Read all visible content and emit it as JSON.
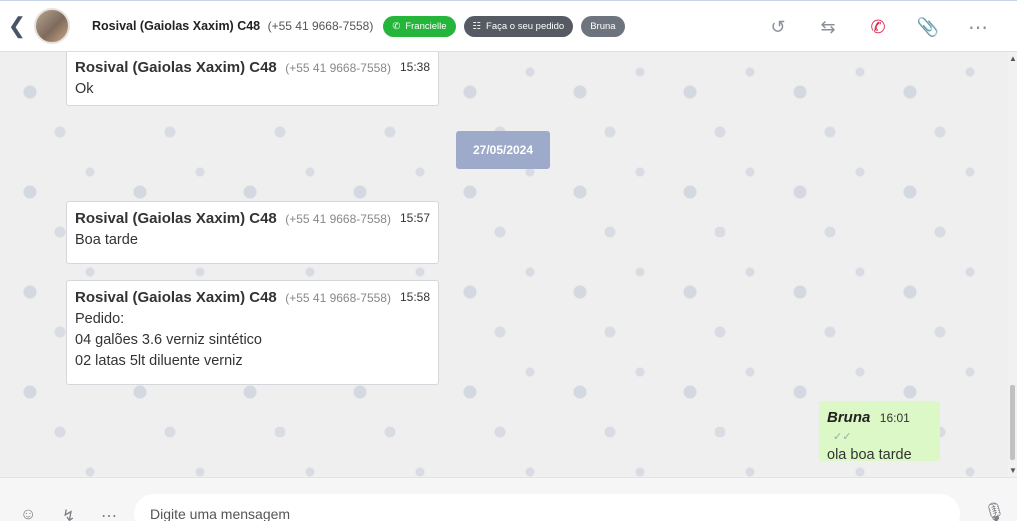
{
  "header": {
    "contact_name": "Rosival (Gaiolas Xaxim) C48",
    "contact_phone": "(+55 41 9668-7558)",
    "tags": [
      "Francielle",
      "Faça o seu pedido",
      "Bruna"
    ],
    "icons": [
      "history-icon",
      "transfer-icon",
      "call-end-icon",
      "attach-icon",
      "more-icon"
    ]
  },
  "messages": [
    {
      "name": "Rosival (Gaiolas Xaxim) C48",
      "phone": "(+55 41 9668-7558)",
      "time": "15:38",
      "lines": [
        "Ok"
      ]
    },
    {
      "name": "Rosival (Gaiolas Xaxim) C48",
      "phone": "(+55 41 9668-7558)",
      "time": "15:57",
      "lines": [
        "Boa tarde"
      ]
    },
    {
      "name": "Rosival (Gaiolas Xaxim) C48",
      "phone": "(+55 41 9668-7558)",
      "time": "15:58",
      "lines": [
        "Pedido:",
        "04 galões 3.6 verniz sintético",
        "02 latas 5lt diluente verniz"
      ]
    }
  ],
  "date_separator": "27/05/2024",
  "outgoing": {
    "name": "Bruna",
    "time": "16:01",
    "text": "ola boa tarde"
  },
  "composer": {
    "placeholder": "Digite uma mensagem"
  },
  "colors": {
    "whatsapp_tag": "#25b53b",
    "outgoing_bubble": "#dcf8c6",
    "date_pill": "#9daac9",
    "call_end": "#e0284b"
  }
}
